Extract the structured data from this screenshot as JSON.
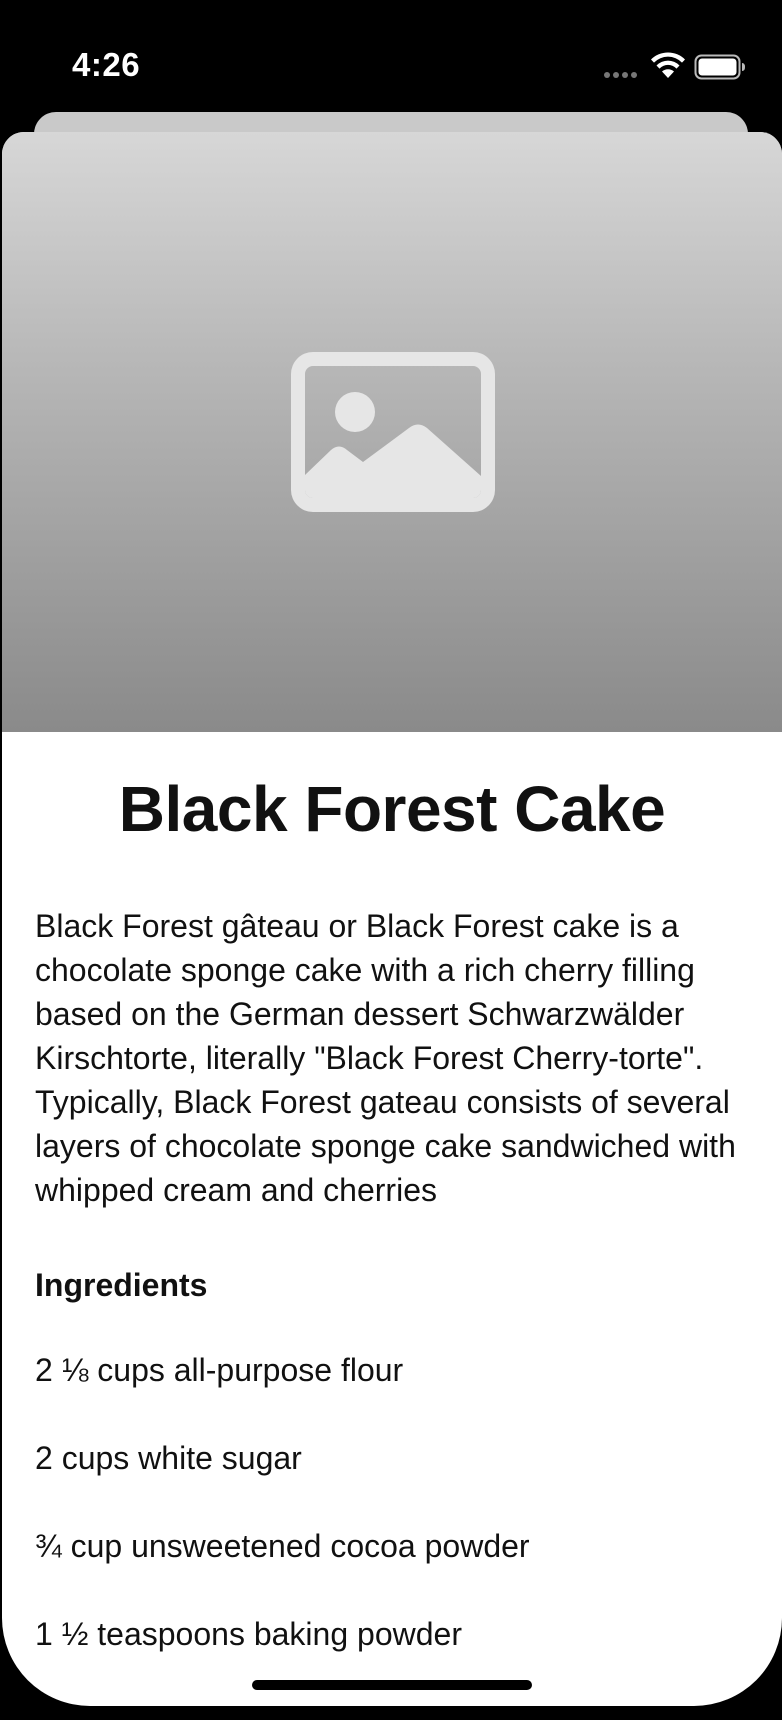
{
  "status_bar": {
    "time": "4:26"
  },
  "recipe": {
    "title": "Black Forest Cake",
    "description": "Black Forest gâteau or Black Forest cake is a chocolate sponge cake with a rich cherry filling based on the German dessert Schwarzwälder Kirschtorte, literally \"Black Forest Cherry-torte\". Typically, Black Forest gateau consists of several layers of chocolate sponge cake sandwiched with whipped cream and cherries",
    "ingredients_heading": "Ingredients",
    "ingredients": [
      "2 ⅛ cups all-purpose flour",
      "2 cups white sugar",
      "¾ cup unsweetened cocoa powder",
      "1 ½ teaspoons baking powder"
    ]
  },
  "icons": {
    "hero": "image-placeholder-icon",
    "wifi": "wifi-icon",
    "battery": "battery-icon"
  },
  "colors": {
    "hero_top": "#d7d7d7",
    "hero_bottom": "#8a8a8a",
    "placeholder_icon": "#e6e6e6"
  }
}
